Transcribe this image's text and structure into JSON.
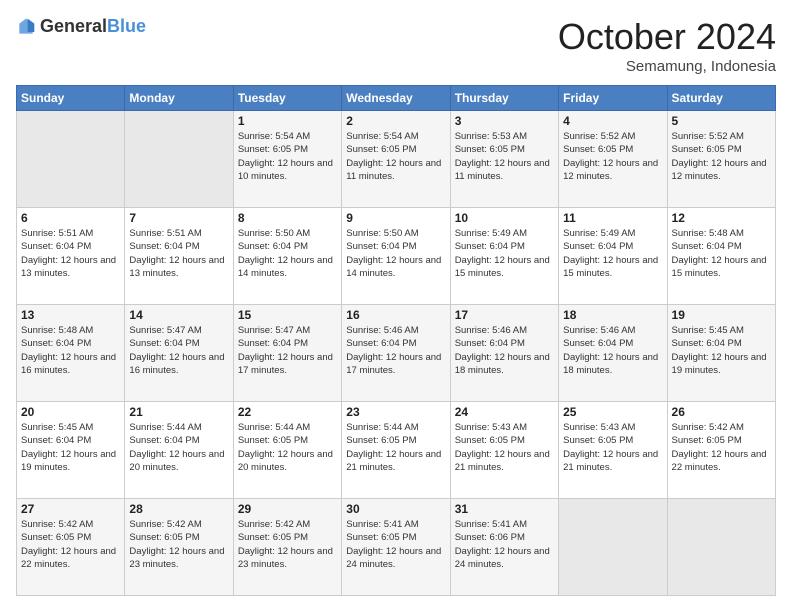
{
  "header": {
    "logo_general": "General",
    "logo_blue": "Blue",
    "month": "October 2024",
    "location": "Semamung, Indonesia"
  },
  "weekdays": [
    "Sunday",
    "Monday",
    "Tuesday",
    "Wednesday",
    "Thursday",
    "Friday",
    "Saturday"
  ],
  "weeks": [
    [
      {
        "day": "",
        "sunrise": "",
        "sunset": "",
        "daylight": ""
      },
      {
        "day": "",
        "sunrise": "",
        "sunset": "",
        "daylight": ""
      },
      {
        "day": "1",
        "sunrise": "Sunrise: 5:54 AM",
        "sunset": "Sunset: 6:05 PM",
        "daylight": "Daylight: 12 hours and 10 minutes."
      },
      {
        "day": "2",
        "sunrise": "Sunrise: 5:54 AM",
        "sunset": "Sunset: 6:05 PM",
        "daylight": "Daylight: 12 hours and 11 minutes."
      },
      {
        "day": "3",
        "sunrise": "Sunrise: 5:53 AM",
        "sunset": "Sunset: 6:05 PM",
        "daylight": "Daylight: 12 hours and 11 minutes."
      },
      {
        "day": "4",
        "sunrise": "Sunrise: 5:52 AM",
        "sunset": "Sunset: 6:05 PM",
        "daylight": "Daylight: 12 hours and 12 minutes."
      },
      {
        "day": "5",
        "sunrise": "Sunrise: 5:52 AM",
        "sunset": "Sunset: 6:05 PM",
        "daylight": "Daylight: 12 hours and 12 minutes."
      }
    ],
    [
      {
        "day": "6",
        "sunrise": "Sunrise: 5:51 AM",
        "sunset": "Sunset: 6:04 PM",
        "daylight": "Daylight: 12 hours and 13 minutes."
      },
      {
        "day": "7",
        "sunrise": "Sunrise: 5:51 AM",
        "sunset": "Sunset: 6:04 PM",
        "daylight": "Daylight: 12 hours and 13 minutes."
      },
      {
        "day": "8",
        "sunrise": "Sunrise: 5:50 AM",
        "sunset": "Sunset: 6:04 PM",
        "daylight": "Daylight: 12 hours and 14 minutes."
      },
      {
        "day": "9",
        "sunrise": "Sunrise: 5:50 AM",
        "sunset": "Sunset: 6:04 PM",
        "daylight": "Daylight: 12 hours and 14 minutes."
      },
      {
        "day": "10",
        "sunrise": "Sunrise: 5:49 AM",
        "sunset": "Sunset: 6:04 PM",
        "daylight": "Daylight: 12 hours and 15 minutes."
      },
      {
        "day": "11",
        "sunrise": "Sunrise: 5:49 AM",
        "sunset": "Sunset: 6:04 PM",
        "daylight": "Daylight: 12 hours and 15 minutes."
      },
      {
        "day": "12",
        "sunrise": "Sunrise: 5:48 AM",
        "sunset": "Sunset: 6:04 PM",
        "daylight": "Daylight: 12 hours and 15 minutes."
      }
    ],
    [
      {
        "day": "13",
        "sunrise": "Sunrise: 5:48 AM",
        "sunset": "Sunset: 6:04 PM",
        "daylight": "Daylight: 12 hours and 16 minutes."
      },
      {
        "day": "14",
        "sunrise": "Sunrise: 5:47 AM",
        "sunset": "Sunset: 6:04 PM",
        "daylight": "Daylight: 12 hours and 16 minutes."
      },
      {
        "day": "15",
        "sunrise": "Sunrise: 5:47 AM",
        "sunset": "Sunset: 6:04 PM",
        "daylight": "Daylight: 12 hours and 17 minutes."
      },
      {
        "day": "16",
        "sunrise": "Sunrise: 5:46 AM",
        "sunset": "Sunset: 6:04 PM",
        "daylight": "Daylight: 12 hours and 17 minutes."
      },
      {
        "day": "17",
        "sunrise": "Sunrise: 5:46 AM",
        "sunset": "Sunset: 6:04 PM",
        "daylight": "Daylight: 12 hours and 18 minutes."
      },
      {
        "day": "18",
        "sunrise": "Sunrise: 5:46 AM",
        "sunset": "Sunset: 6:04 PM",
        "daylight": "Daylight: 12 hours and 18 minutes."
      },
      {
        "day": "19",
        "sunrise": "Sunrise: 5:45 AM",
        "sunset": "Sunset: 6:04 PM",
        "daylight": "Daylight: 12 hours and 19 minutes."
      }
    ],
    [
      {
        "day": "20",
        "sunrise": "Sunrise: 5:45 AM",
        "sunset": "Sunset: 6:04 PM",
        "daylight": "Daylight: 12 hours and 19 minutes."
      },
      {
        "day": "21",
        "sunrise": "Sunrise: 5:44 AM",
        "sunset": "Sunset: 6:04 PM",
        "daylight": "Daylight: 12 hours and 20 minutes."
      },
      {
        "day": "22",
        "sunrise": "Sunrise: 5:44 AM",
        "sunset": "Sunset: 6:05 PM",
        "daylight": "Daylight: 12 hours and 20 minutes."
      },
      {
        "day": "23",
        "sunrise": "Sunrise: 5:44 AM",
        "sunset": "Sunset: 6:05 PM",
        "daylight": "Daylight: 12 hours and 21 minutes."
      },
      {
        "day": "24",
        "sunrise": "Sunrise: 5:43 AM",
        "sunset": "Sunset: 6:05 PM",
        "daylight": "Daylight: 12 hours and 21 minutes."
      },
      {
        "day": "25",
        "sunrise": "Sunrise: 5:43 AM",
        "sunset": "Sunset: 6:05 PM",
        "daylight": "Daylight: 12 hours and 21 minutes."
      },
      {
        "day": "26",
        "sunrise": "Sunrise: 5:42 AM",
        "sunset": "Sunset: 6:05 PM",
        "daylight": "Daylight: 12 hours and 22 minutes."
      }
    ],
    [
      {
        "day": "27",
        "sunrise": "Sunrise: 5:42 AM",
        "sunset": "Sunset: 6:05 PM",
        "daylight": "Daylight: 12 hours and 22 minutes."
      },
      {
        "day": "28",
        "sunrise": "Sunrise: 5:42 AM",
        "sunset": "Sunset: 6:05 PM",
        "daylight": "Daylight: 12 hours and 23 minutes."
      },
      {
        "day": "29",
        "sunrise": "Sunrise: 5:42 AM",
        "sunset": "Sunset: 6:05 PM",
        "daylight": "Daylight: 12 hours and 23 minutes."
      },
      {
        "day": "30",
        "sunrise": "Sunrise: 5:41 AM",
        "sunset": "Sunset: 6:05 PM",
        "daylight": "Daylight: 12 hours and 24 minutes."
      },
      {
        "day": "31",
        "sunrise": "Sunrise: 5:41 AM",
        "sunset": "Sunset: 6:06 PM",
        "daylight": "Daylight: 12 hours and 24 minutes."
      },
      {
        "day": "",
        "sunrise": "",
        "sunset": "",
        "daylight": ""
      },
      {
        "day": "",
        "sunrise": "",
        "sunset": "",
        "daylight": ""
      }
    ]
  ]
}
